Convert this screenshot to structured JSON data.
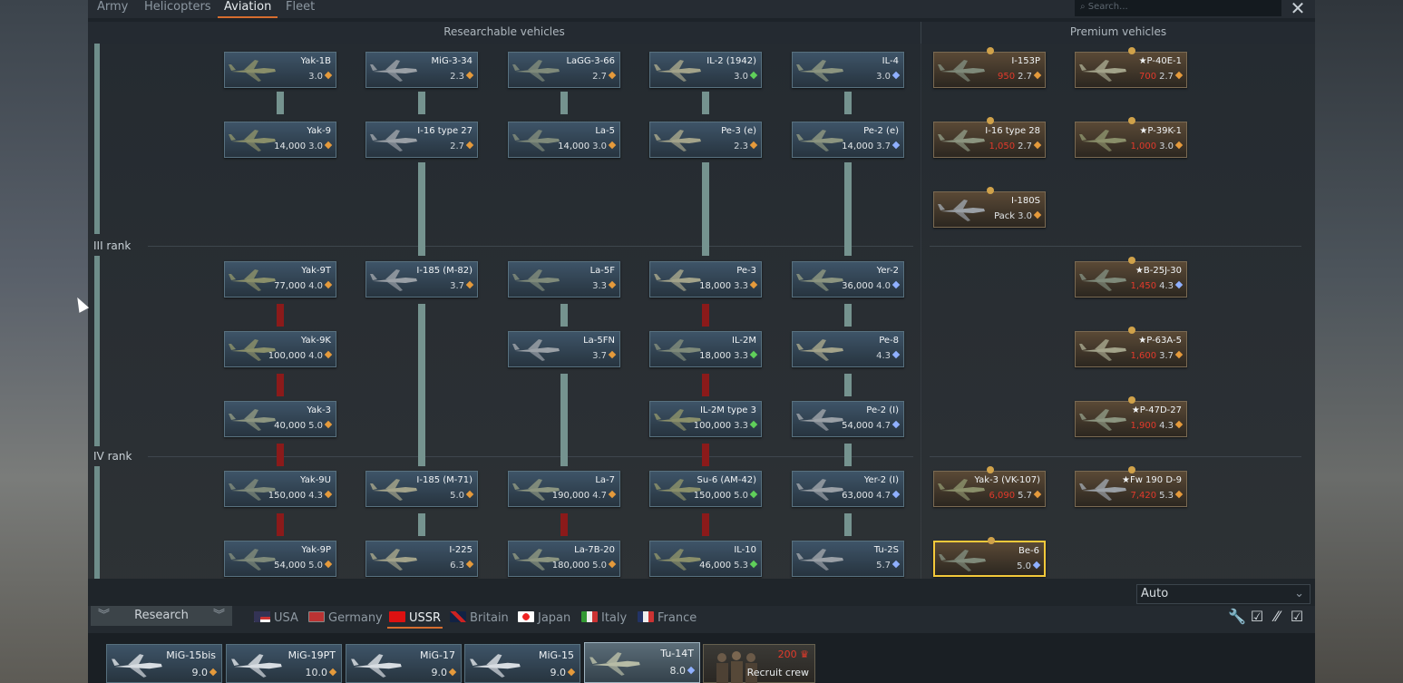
{
  "tabs": [
    "Army",
    "Helicopters",
    "Aviation",
    "Fleet"
  ],
  "active_tab": "Aviation",
  "search": {
    "placeholder": "Search..."
  },
  "sections": {
    "researchable": "Researchable vehicles",
    "premium": "Premium vehicles"
  },
  "ranks": [
    "III rank",
    "IV rank"
  ],
  "researchable": [
    {
      "name": "Yak-1B",
      "cost": "",
      "br": "3.0",
      "type": "orange"
    },
    {
      "name": "MiG-3-34",
      "cost": "",
      "br": "2.3",
      "type": "orange"
    },
    {
      "name": "LaGG-3-66",
      "cost": "",
      "br": "2.7",
      "type": "orange"
    },
    {
      "name": "IL-2 (1942)",
      "cost": "",
      "br": "3.0",
      "type": "green"
    },
    {
      "name": "IL-4",
      "cost": "",
      "br": "3.0",
      "type": "blue"
    },
    {
      "name": "Yak-9",
      "cost": "14,000",
      "br": "3.0",
      "type": "orange"
    },
    {
      "name": "I-16 type 27",
      "cost": "",
      "br": "2.7",
      "type": "orange"
    },
    {
      "name": "La-5",
      "cost": "14,000",
      "br": "3.0",
      "type": "orange"
    },
    {
      "name": "Pe-3 (e)",
      "cost": "",
      "br": "2.3",
      "type": "orange"
    },
    {
      "name": "Pe-2 (e)",
      "cost": "14,000",
      "br": "3.7",
      "type": "blue"
    },
    {
      "name": "Yak-9T",
      "cost": "77,000",
      "br": "4.0",
      "type": "orange"
    },
    {
      "name": "I-185 (M-82)",
      "cost": "",
      "br": "3.7",
      "type": "orange"
    },
    {
      "name": "La-5F",
      "cost": "",
      "br": "3.3",
      "type": "orange"
    },
    {
      "name": "Pe-3",
      "cost": "18,000",
      "br": "3.3",
      "type": "orange"
    },
    {
      "name": "Yer-2",
      "cost": "36,000",
      "br": "4.0",
      "type": "blue"
    },
    {
      "name": "Yak-9K",
      "cost": "100,000",
      "br": "4.0",
      "type": "orange"
    },
    {
      "name": "La-5FN",
      "cost": "",
      "br": "3.7",
      "type": "orange"
    },
    {
      "name": "IL-2M",
      "cost": "18,000",
      "br": "3.3",
      "type": "green"
    },
    {
      "name": "Pe-8",
      "cost": "",
      "br": "4.3",
      "type": "blue"
    },
    {
      "name": "Yak-3",
      "cost": "40,000",
      "br": "5.0",
      "type": "orange"
    },
    {
      "name": "IL-2M type 3",
      "cost": "100,000",
      "br": "3.3",
      "type": "green"
    },
    {
      "name": "Pe-2 (I)",
      "cost": "54,000",
      "br": "4.7",
      "type": "blue"
    },
    {
      "name": "Yak-9U",
      "cost": "150,000",
      "br": "4.3",
      "type": "orange"
    },
    {
      "name": "I-185 (M-71)",
      "cost": "",
      "br": "5.0",
      "type": "orange"
    },
    {
      "name": "La-7",
      "cost": "190,000",
      "br": "4.7",
      "type": "orange"
    },
    {
      "name": "Su-6 (AM-42)",
      "cost": "150,000",
      "br": "5.0",
      "type": "green"
    },
    {
      "name": "Yer-2 (I)",
      "cost": "63,000",
      "br": "4.7",
      "type": "blue"
    },
    {
      "name": "Yak-9P",
      "cost": "54,000",
      "br": "5.0",
      "type": "orange"
    },
    {
      "name": "I-225",
      "cost": "",
      "br": "6.3",
      "type": "orange"
    },
    {
      "name": "La-7B-20",
      "cost": "180,000",
      "br": "5.0",
      "type": "orange"
    },
    {
      "name": "IL-10",
      "cost": "46,000",
      "br": "5.3",
      "type": "green"
    },
    {
      "name": "Tu-2S",
      "cost": "",
      "br": "5.7",
      "type": "blue"
    }
  ],
  "premium": [
    {
      "name": "I-153P",
      "gold": "950",
      "br": "2.7",
      "type": "orange"
    },
    {
      "name": "★P-40E-1",
      "gold": "700",
      "br": "2.7",
      "type": "orange"
    },
    {
      "name": "I-16 type 28",
      "gold": "1,050",
      "br": "2.7",
      "type": "orange"
    },
    {
      "name": "★P-39K-1",
      "gold": "1,000",
      "br": "3.0",
      "type": "orange"
    },
    {
      "name": "I-180S",
      "gold": "Pack",
      "br": "3.0",
      "type": "orange"
    },
    {
      "name": "★B-25J-30",
      "gold": "1,450",
      "br": "4.3",
      "type": "blue"
    },
    {
      "name": "★P-63A-5",
      "gold": "1,600",
      "br": "3.7",
      "type": "orange"
    },
    {
      "name": "★P-47D-27",
      "gold": "1,900",
      "br": "4.3",
      "type": "orange"
    },
    {
      "name": "Yak-3 (VK-107)",
      "gold": "6,090",
      "br": "5.7",
      "type": "orange"
    },
    {
      "name": "★Fw 190 D-9",
      "gold": "7,420",
      "br": "5.3",
      "type": "orange"
    },
    {
      "name": "Be-6",
      "gold": "",
      "br": "5.0",
      "type": "blue"
    }
  ],
  "dropdown": {
    "value": "Auto"
  },
  "research_button": "Research",
  "nations": [
    "USA",
    "Germany",
    "USSR",
    "Britain",
    "Japan",
    "Italy",
    "France"
  ],
  "active_nation": "USSR",
  "slots": [
    {
      "name": "MiG-15bis",
      "br": "9.0",
      "type": "orange"
    },
    {
      "name": "MiG-19PT",
      "br": "10.0",
      "type": "orange"
    },
    {
      "name": "MiG-17",
      "br": "9.0",
      "type": "orange"
    },
    {
      "name": "MiG-15",
      "br": "9.0",
      "type": "orange"
    },
    {
      "name": "Tu-14T",
      "br": "8.0",
      "type": "blue"
    }
  ],
  "crew": {
    "cost": "200",
    "label": "Recruit crew"
  },
  "colors": {
    "orange": "#e59a3b",
    "green": "#5fcf5a",
    "blue": "#8fb0ff",
    "accent": "#d66d2f",
    "gold_text": "#e23a2b"
  }
}
